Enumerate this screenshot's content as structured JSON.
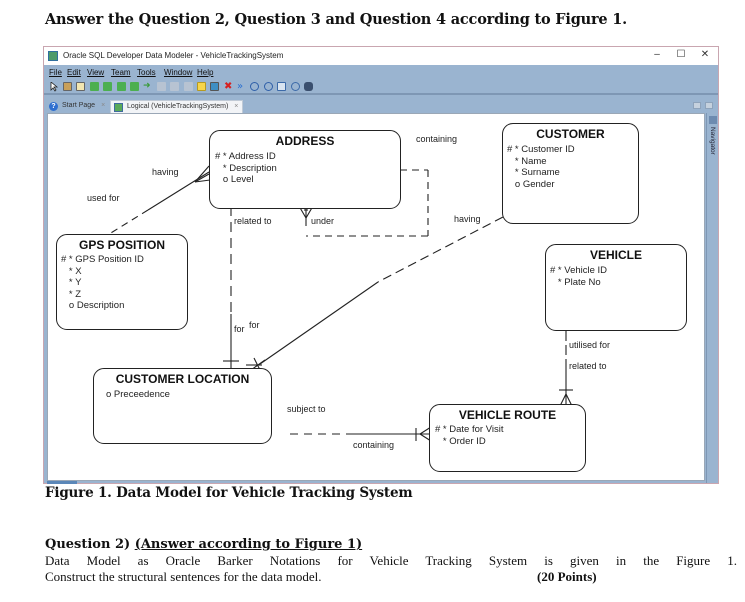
{
  "heading": "Answer the Question 2, Question 3 and Question 4 according to Figure 1.",
  "window": {
    "title": "Oracle SQL Developer Data Modeler - VehicleTrackingSystem",
    "controls": {
      "minimize": "–",
      "maximize": "☐",
      "close": "✕"
    },
    "menu": [
      "File",
      "Edit",
      "View",
      "Team",
      "Tools",
      "Window",
      "Help"
    ],
    "toolbar_icons": [
      "select-icon",
      "new-entity-icon",
      "new-view-icon",
      "relation-1n-icon",
      "relation-11-icon",
      "relation-mn-icon",
      "relation-identifying-icon",
      "arrow-icon",
      "disabled-1-icon",
      "disabled-2-icon",
      "disabled-3-icon",
      "note-icon",
      "picture-icon",
      "delete-icon",
      "engineer-icon",
      "zoom-in-icon",
      "zoom-out-icon",
      "fit-screen-icon",
      "refresh-icon",
      "find-icon"
    ],
    "tabs": [
      {
        "label": "Start Page",
        "icon": "help-icon",
        "active": false
      },
      {
        "label": "Logical (VehicleTrackingSystem)",
        "icon": "logical-model-icon",
        "active": true
      }
    ],
    "side_panel_label": "Navigator"
  },
  "entities": {
    "address": {
      "name": "ADDRESS",
      "attributes": [
        "# * Address ID",
        "   * Description",
        "   o Level"
      ]
    },
    "customer": {
      "name": "CUSTOMER",
      "attributes": [
        "# * Customer ID",
        "   * Name",
        "   * Surname",
        "   o Gender"
      ]
    },
    "gps": {
      "name": "GPS POSITION",
      "attributes": [
        "# * GPS Position ID",
        "   * X",
        "   * Y",
        "   * Z",
        "   o Description"
      ]
    },
    "vehicle": {
      "name": "VEHICLE",
      "attributes": [
        "# * Vehicle ID",
        "   * Plate No"
      ]
    },
    "customer_location": {
      "name": "CUSTOMER LOCATION",
      "attributes": [
        "o Preceedence"
      ]
    },
    "vehicle_route": {
      "name": "VEHICLE ROUTE",
      "attributes": [
        "# * Date for Visit",
        "   * Order ID"
      ]
    }
  },
  "relationship_labels": {
    "address_gps_having": "having",
    "gps_address_used_for": "used for",
    "address_self_containing": "containing",
    "address_self_under": "under",
    "address_custloc_related_to": "related to",
    "custloc_address_for": "for",
    "custloc_customer_for": "for",
    "customer_custloc_having": "having",
    "vehicle_route_utilised_for": "utilised for",
    "route_vehicle_related_to": "related to",
    "custloc_route_subject_to": "subject to",
    "route_custloc_containing": "containing"
  },
  "caption": "Figure 1. Data Model for Vehicle Tracking System",
  "question": {
    "number": "Question 2)",
    "note": "(Answer according to Figure 1)",
    "line1": "Data Model as Oracle Barker Notations for Vehicle Tracking System is given in the Figure 1.",
    "line2": "Construct the structural sentences for the data model.",
    "points": "(20 Points)"
  }
}
